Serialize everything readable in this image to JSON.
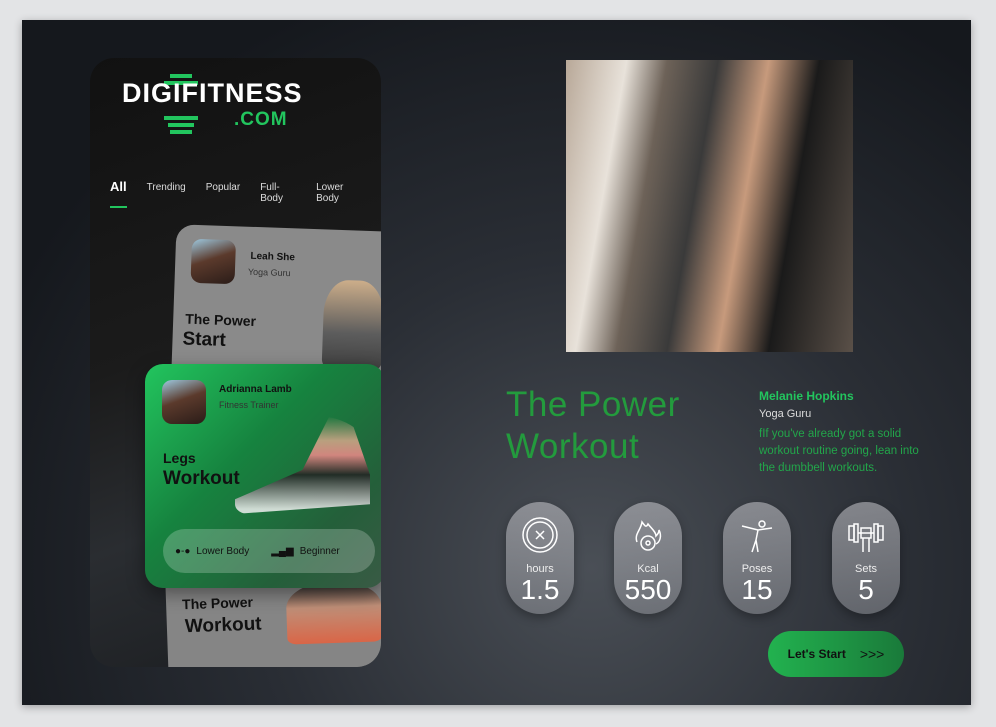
{
  "brand": {
    "name": "DIGIFITNESS",
    "domain": ".COM"
  },
  "tabs": [
    "All",
    "Trending",
    "Popular",
    "Full-Body",
    "Lower Body"
  ],
  "cards": [
    {
      "trainer": "Leah She",
      "role": "Yoga Guru",
      "title1": "The Power",
      "title2": "Start"
    },
    {
      "trainer": "Adrianna Lamb",
      "role": "Fitness Trainer",
      "title1": "Legs",
      "title2": "Workout",
      "tag1": "Lower Body",
      "tag2": "Beginner"
    },
    {
      "title1": "The Power",
      "title2": "Workout"
    }
  ],
  "detail": {
    "title_line1": "The Power",
    "title_line2": "Workout",
    "trainer": "Melanie Hopkins",
    "role": "Yoga Guru",
    "description": "fIf you've already got a solid workout routine going, lean into the dumbbell workouts."
  },
  "stats": [
    {
      "label": "hours",
      "value": "1.5",
      "icon": "clock-icon"
    },
    {
      "label": "Kcal",
      "value": "550",
      "icon": "fire-icon"
    },
    {
      "label": "Poses",
      "value": "15",
      "icon": "yoga-pose-icon"
    },
    {
      "label": "Sets",
      "value": "5",
      "icon": "dumbbell-icon"
    }
  ],
  "cta": {
    "label": "Let's Start",
    "arrows": ">>>"
  },
  "colors": {
    "accent": "#22c55e",
    "title": "#239b3d"
  }
}
